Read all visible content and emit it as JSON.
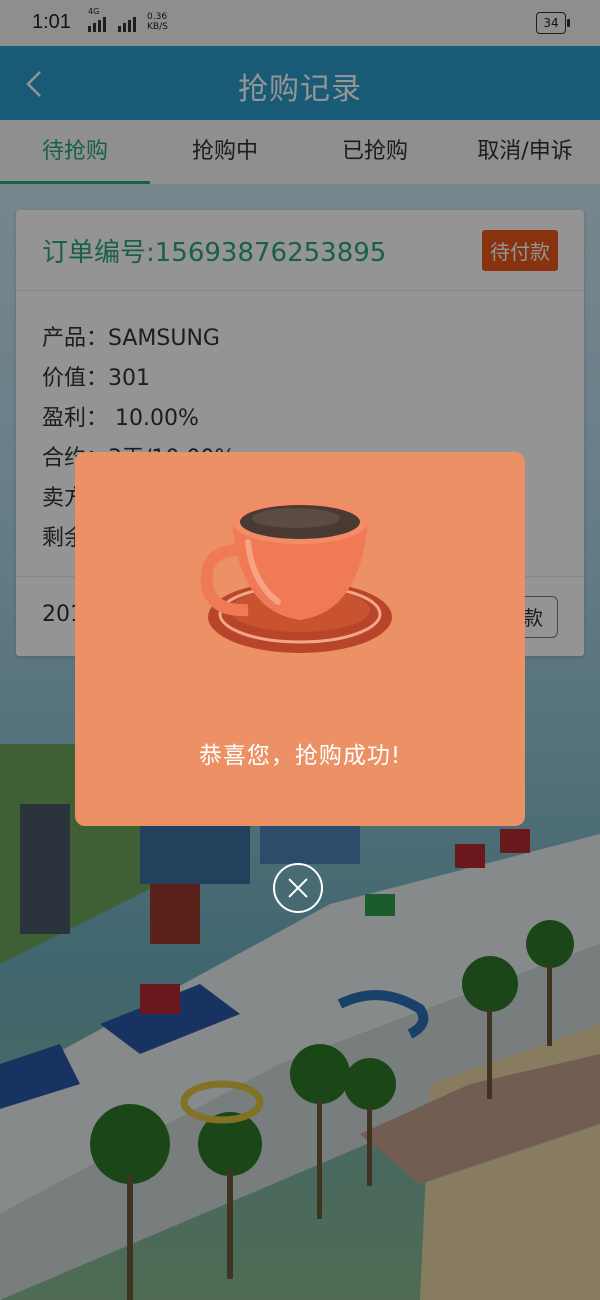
{
  "status_bar": {
    "time": "1:01",
    "network": "4G",
    "speed_value": "0.36",
    "speed_unit": "KB/S",
    "battery": "34"
  },
  "header": {
    "title": "抢购记录",
    "back_icon": "chevron-left-icon"
  },
  "tabs": [
    {
      "label": "待抢购",
      "active": true
    },
    {
      "label": "抢购中",
      "active": false
    },
    {
      "label": "已抢购",
      "active": false
    },
    {
      "label": "取消/申诉",
      "active": false
    }
  ],
  "order": {
    "order_no": "订单编号:15693876253895",
    "status": "待付款",
    "product": "产品：SAMSUNG",
    "value": "价值：301",
    "profit": "盈利：  10.00%",
    "contract": "合约：3天/10.00%",
    "seller": "卖方",
    "remaining": "剩余",
    "date_prefix": "201",
    "pay_button": "款"
  },
  "modal": {
    "message": "恭喜您，抢购成功!",
    "icon": "coffee-cup-icon",
    "close_icon": "close-icon"
  },
  "colors": {
    "header": "#2c9bcd",
    "tab_active": "#2aa776",
    "badge": "#e8581a",
    "modal": "#ec9165"
  }
}
